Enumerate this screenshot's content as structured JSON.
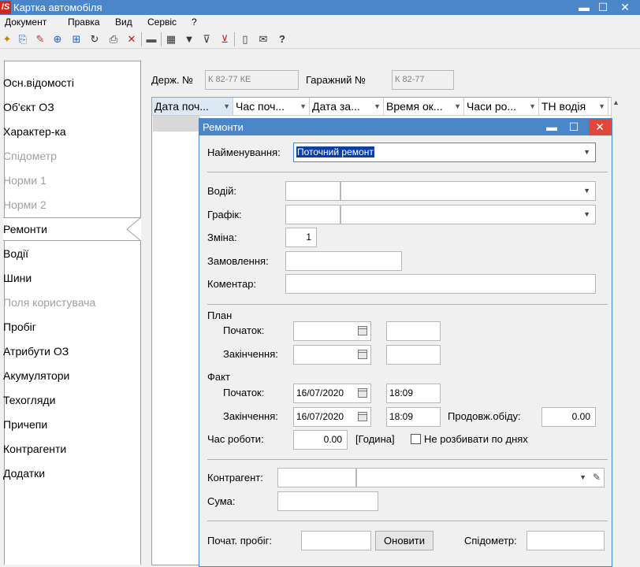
{
  "window": {
    "app_icon": "IS",
    "title": "Картка автомобіля",
    "controls": {
      "minimize": "▬",
      "maximize": "☐",
      "close": "✕"
    }
  },
  "menu": [
    {
      "label": "Документ"
    },
    {
      "label": "Правка"
    },
    {
      "label": "Вид"
    },
    {
      "label": "Сервіс"
    },
    {
      "label": "?"
    }
  ],
  "toolbar": {
    "icons": [
      "new-doc-icon",
      "new-doc-copy-icon",
      "edit-doc-icon",
      "add-doc-icon",
      "add-doc-2-icon",
      "refresh-icon",
      "print-icon",
      "delete-icon",
      "monitor-icon",
      "table-icon",
      "filter-icon",
      "filter-add-icon",
      "filter-clear-icon",
      "document-icon",
      "email-icon",
      "help-icon"
    ]
  },
  "sidebar": {
    "items": [
      {
        "label": "Осн.відомості",
        "disabled": false
      },
      {
        "label": "Об'єкт ОЗ",
        "disabled": false
      },
      {
        "label": "Характер-ка",
        "disabled": false
      },
      {
        "label": "Спідометр",
        "disabled": true
      },
      {
        "label": "Норми 1",
        "disabled": true
      },
      {
        "label": "Норми 2",
        "disabled": true
      },
      {
        "label": "Ремонти",
        "disabled": false,
        "active": true
      },
      {
        "label": "Водії",
        "disabled": false
      },
      {
        "label": "Шини",
        "disabled": false
      },
      {
        "label": "Поля користувача",
        "disabled": true
      },
      {
        "label": "Пробіг",
        "disabled": false
      },
      {
        "label": "Атрибути ОЗ",
        "disabled": false
      },
      {
        "label": "Акумулятори",
        "disabled": false
      },
      {
        "label": "Техогляди",
        "disabled": false
      },
      {
        "label": "Причепи",
        "disabled": false
      },
      {
        "label": "Контрагенти",
        "disabled": false
      },
      {
        "label": "Додатки",
        "disabled": false
      }
    ]
  },
  "header": {
    "reg_label": "Держ. №",
    "reg_value": "К 82-77 КЕ",
    "garage_label": "Гаражний №",
    "garage_value": "К 82-77"
  },
  "grid": {
    "columns": [
      "Дата поч...",
      "Час поч...",
      "Дата за...",
      "Время ок...",
      "Часи ро...",
      "ТН водія"
    ]
  },
  "dialog": {
    "title": "Ремонти",
    "name_label": "Найменування:",
    "name_value": "Поточний ремонт",
    "driver_label": "Водій:",
    "schedule_label": "Графік:",
    "shift_label": "Зміна:",
    "shift_value": "1",
    "order_label": "Замовлення:",
    "comment_label": "Коментар:",
    "plan_label": "План",
    "plan_start_label": "Початок:",
    "plan_end_label": "Закінчення:",
    "fact_label": "Факт",
    "fact_start_label": "Початок:",
    "fact_start_date": "16/07/2020",
    "fact_start_time": "18:09",
    "fact_end_label": "Закінчення:",
    "fact_end_date": "16/07/2020",
    "fact_end_time": "18:09",
    "downtime_label": "Продовж.обіду:",
    "downtime_value": "0.00",
    "worktime_label": "Час роботи:",
    "worktime_value": "0.00",
    "worktime_unit": "[Година]",
    "no_split_label": "Не розбивати по днях",
    "counterparty_label": "Контрагент:",
    "sum_label": "Сума:",
    "start_mileage_label": "Почат. пробіг:",
    "update_button": "Оновити",
    "speedometer_label": "Спідометр:"
  }
}
